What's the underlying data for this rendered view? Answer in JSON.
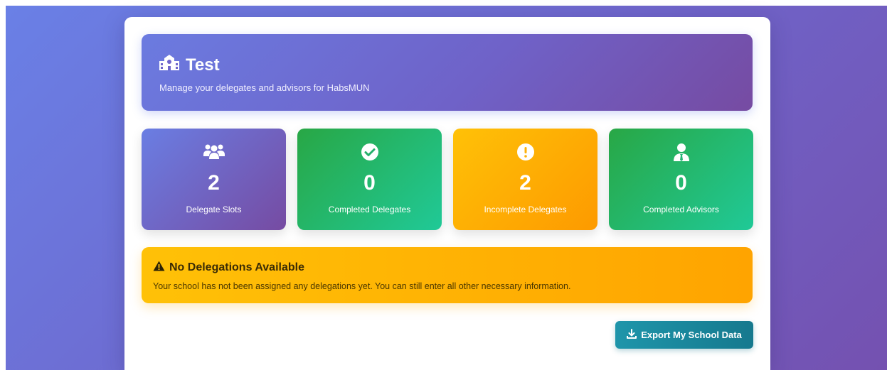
{
  "header": {
    "title": "Test",
    "subtitle": "Manage your delegates and advisors for HabsMUN",
    "icon": "school-icon"
  },
  "stats": [
    {
      "value": "2",
      "label": "Delegate Slots",
      "icon": "users-icon",
      "color": "#6a7ee3"
    },
    {
      "value": "0",
      "label": "Completed Delegates",
      "icon": "check-circle-icon",
      "color": "#28a745"
    },
    {
      "value": "2",
      "label": "Incomplete Delegates",
      "icon": "exclamation-circle-icon",
      "color": "#ffc107"
    },
    {
      "value": "0",
      "label": "Completed Advisors",
      "icon": "user-tie-icon",
      "color": "#28a745"
    }
  ],
  "alert": {
    "title": "No Delegations Available",
    "text": "Your school has not been assigned any delegations yet. You can still enter all other necessary information.",
    "icon": "warning-icon",
    "color": "#ffc107"
  },
  "export": {
    "label": "Export My School Data",
    "icon": "download-icon",
    "color": "#17a2b8"
  }
}
